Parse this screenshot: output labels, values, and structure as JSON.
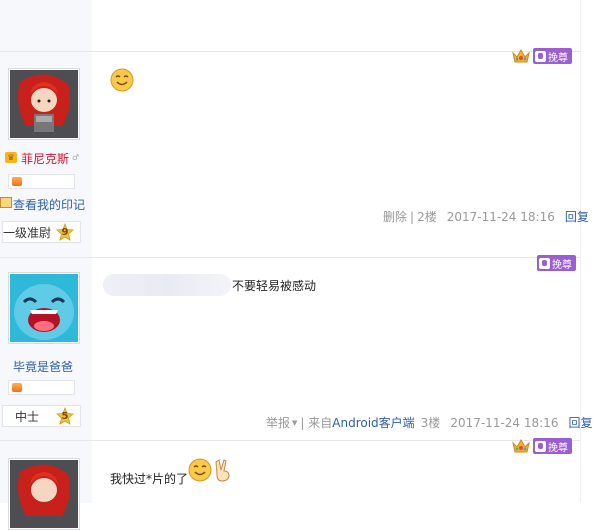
{
  "floor2": {
    "user_name": "菲尼克斯",
    "view_mark_link": "查看我的印记",
    "level_name": "一级准尉",
    "level_num": "9",
    "actions": {
      "delete": "删除",
      "sep": "|",
      "floor": "2楼",
      "time": "2017-11-24 18:16",
      "reply": "回复"
    },
    "zan_label": "挽尊"
  },
  "floor3": {
    "content": "不要轻易被感动",
    "user_name": "毕竟是爸爸",
    "level_name": "中士",
    "level_num": "5",
    "actions": {
      "report": "举报",
      "from": "| 来自",
      "client": "Android客户端",
      "floor": "3楼",
      "time": "2017-11-24 18:16",
      "reply": "回复"
    },
    "zan_label": "挽尊"
  },
  "floor4": {
    "content": "我快过*片的了",
    "zan_label": "挽尊"
  },
  "colors": {
    "accent_purple": "#9c5fd2",
    "link_blue": "#2f5fa9",
    "vip_red": "#e1102b",
    "meta_gray": "#999999"
  },
  "icons": [
    "crown-icon",
    "zan-icon",
    "smiley-icon",
    "victory-hand-icon",
    "vip-icon",
    "book-icon",
    "level-star-icon",
    "badge-icon",
    "dropdown-arrow-icon"
  ]
}
